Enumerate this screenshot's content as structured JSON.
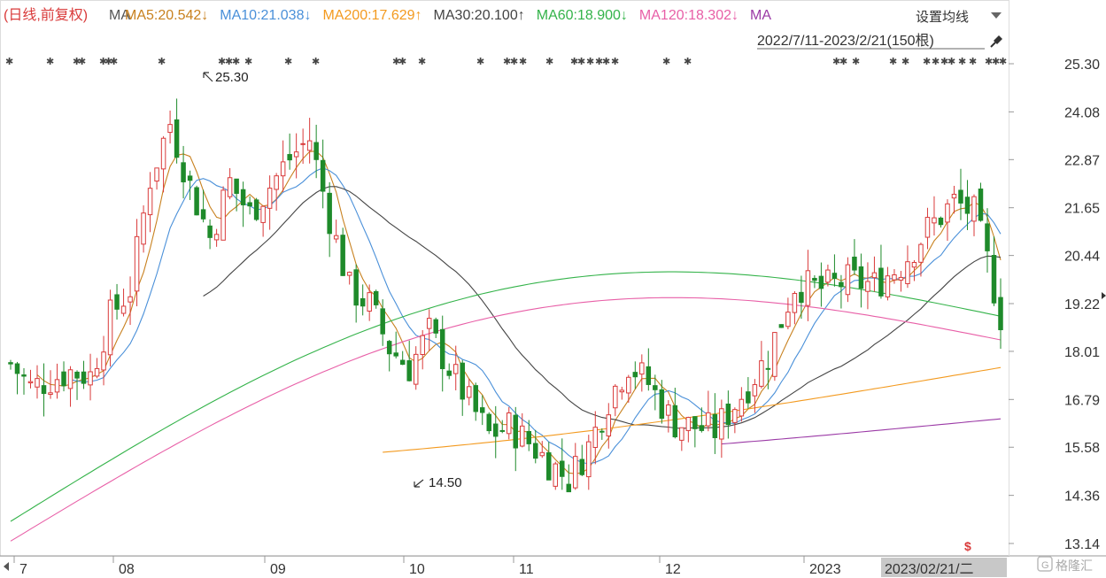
{
  "chart_data": {
    "type": "candlestick",
    "header": {
      "mode_label": "(日线,前复权)",
      "ma_prefix": "MA",
      "settings_label": "设置均线",
      "range_label": "2022/7/11-2023/2/21(150根)",
      "ma_items": [
        {
          "text": "MA5:20.542↓",
          "color": "#c8811f"
        },
        {
          "text": "MA10:21.038↓",
          "color": "#4a90d9"
        },
        {
          "text": "MA200:17.629↑",
          "color": "#f39a1f"
        },
        {
          "text": "MA30:20.100↑",
          "color": "#444444"
        },
        {
          "text": "MA60:18.900↓",
          "color": "#34b34a"
        },
        {
          "text": "MA120:18.302↓",
          "color": "#e85fa7"
        },
        {
          "text": "MA",
          "color": "#9b3aa6"
        }
      ]
    },
    "y_ticks": [
      "25.30",
      "24.08",
      "22.87",
      "21.65",
      "20.44",
      "19.22",
      "18.01",
      "16.79",
      "15.58",
      "14.36",
      "13.14"
    ],
    "ylim": [
      13.14,
      25.3
    ],
    "x_ticks": [
      "7",
      "08",
      "09",
      "10",
      "11",
      "12",
      "2023"
    ],
    "cursor_date": "2023/02/21/二",
    "annotations": [
      {
        "text": "25.30",
        "value": 25.3
      },
      {
        "text": "14.50",
        "value": 14.5
      }
    ],
    "watermark": "格隆汇",
    "colors": {
      "up": "#d93a3a",
      "down": "#1e8a2a",
      "ma5": "#c8811f",
      "ma10": "#4a90d9",
      "ma30": "#444444",
      "ma60": "#34b34a",
      "ma120": "#e85fa7",
      "ma200": "#f39a1f",
      "ma250": "#9b3aa6"
    }
  }
}
